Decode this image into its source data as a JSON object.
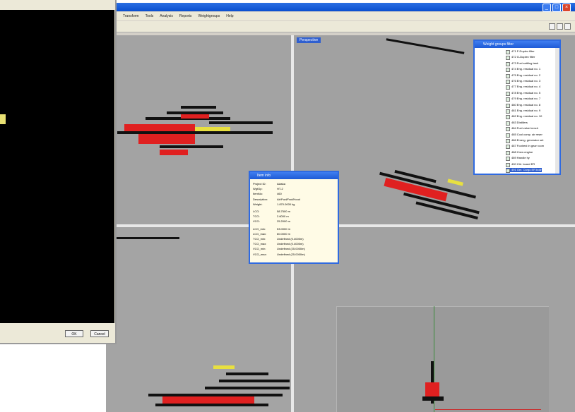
{
  "menubar": {
    "items": [
      "Transform",
      "Tools",
      "Analysis",
      "Reports",
      "Weightgroups",
      "Help"
    ]
  },
  "viewports": {
    "perspective_label": "Perspective"
  },
  "weight_groups_panel": {
    "title": "Weight groups filter",
    "items": [
      "471 F-Duplex filter",
      "472 G-Duplex filter",
      "473 Fuel settling tank",
      "474 Eng. residual no. 1",
      "475 Eng. residual no. 2",
      "476 Eng. residual no. 3",
      "477 Eng. residual no. 4",
      "478 Eng. residual no. 5",
      "479 Eng. residual no. 7",
      "480 Eng. residual no. 8",
      "481 Eng. residual no. 9",
      "482 Eng. residual no. 10",
      "483 Distillers",
      "484 Fuel valve bench",
      "485 Cool comp. air reser",
      "486 Emerg. generator set",
      "487 Footrest in gear room",
      "488 Crew engine",
      "489 Handle hy",
      "490 Ctrl. board ER",
      "491 Ger. Cargo ER boilr"
    ],
    "selected_index": 20
  },
  "item_info": {
    "title": "Item info",
    "rows": [
      {
        "label": "Project ID:",
        "value": "Alaska"
      },
      {
        "label": "WgtGp:",
        "value": "HT-2"
      },
      {
        "label": "ItemNo:",
        "value": "460"
      },
      {
        "label": "Description:",
        "value": "Air/Fwd/Fwd/Hood"
      },
      {
        "label": "Weight:",
        "value": "1.870.0000 kg"
      },
      {
        "label": "LCG:",
        "value": "58.7500 m"
      },
      {
        "label": "TCG:",
        "value": "2.6000 m"
      },
      {
        "label": "VCG:",
        "value": "25.2000 m"
      },
      {
        "label": "LCG_min:",
        "value": "53.0000 m"
      },
      {
        "label": "LCG_max:",
        "value": "60.0000 m"
      },
      {
        "label": "TCG_min:",
        "value": "Undefined (0.4000m)"
      },
      {
        "label": "TCG_max:",
        "value": "Undefined (0.4000m)"
      },
      {
        "label": "VCG_min:",
        "value": "Undefined (25.0000m)"
      },
      {
        "label": "VCG_max:",
        "value": "Undefined (25.0000m)"
      }
    ]
  },
  "dialog": {
    "ok_label": "OK",
    "cancel_label": "Cancel"
  },
  "colors": {
    "viewport_bg": "#a2a2a2",
    "title_blue": "#1e5ad6",
    "dialog_canvas": "#000000",
    "highlight_yellow": "#e8e040",
    "red_points": "#e02020"
  }
}
